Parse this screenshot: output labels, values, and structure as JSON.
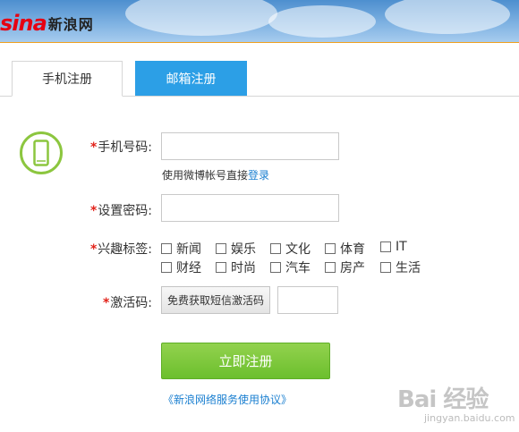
{
  "header": {
    "logo_mark": "sina",
    "logo_text": "新浪网"
  },
  "tabs": [
    {
      "label": "手机注册",
      "active": true
    },
    {
      "label": "邮箱注册",
      "active": false
    }
  ],
  "form": {
    "phone": {
      "label": "手机号码:",
      "value": ""
    },
    "hint": {
      "text": "使用微博帐号直接",
      "link": "登录"
    },
    "password": {
      "label": "设置密码:",
      "value": ""
    },
    "interests": {
      "label": "兴趣标签:",
      "options": [
        "新闻",
        "娱乐",
        "文化",
        "体育",
        "IT",
        "财经",
        "时尚",
        "汽车",
        "房产",
        "生活"
      ]
    },
    "activation": {
      "label": "激活码:",
      "button": "免费获取短信激活码",
      "value": ""
    },
    "required_mark": "*"
  },
  "submit_label": "立即注册",
  "agreement": "《新浪网络服务使用协议》",
  "watermark": {
    "main": "Bai 经验",
    "sub": "jingyan.baidu.com"
  },
  "colors": {
    "tab_active_bg": "#2c9fe6",
    "submit_bg": "#7cc43b",
    "required": "#e2231a",
    "link": "#1a7fd0",
    "accent_rule": "#f0a01e"
  }
}
